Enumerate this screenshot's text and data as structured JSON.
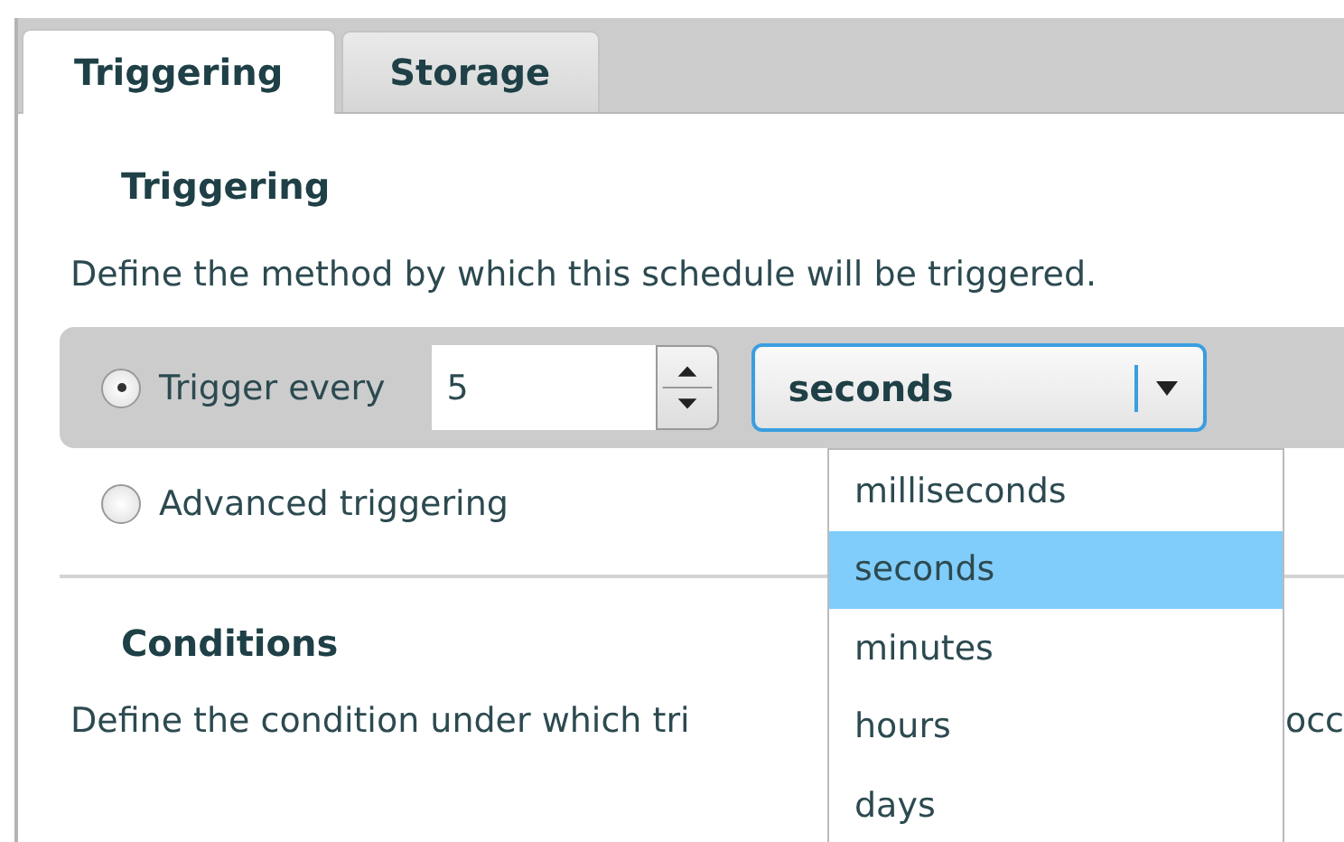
{
  "tabs": [
    {
      "label": "Triggering",
      "selected": true
    },
    {
      "label": "Storage",
      "selected": false
    }
  ],
  "triggering": {
    "heading": "Triggering",
    "description": "Define the method by which this schedule will be triggered.",
    "options": [
      {
        "kind": "interval",
        "label": "Trigger every",
        "selected": true,
        "value": "5",
        "unit": "seconds"
      },
      {
        "kind": "plain",
        "label": "Advanced triggering",
        "selected": false
      }
    ]
  },
  "unit_menu": {
    "items": [
      {
        "label": "milliseconds",
        "selected": false
      },
      {
        "label": "seconds",
        "selected": true
      },
      {
        "label": "minutes",
        "selected": false
      },
      {
        "label": "hours",
        "selected": false
      },
      {
        "label": "days",
        "selected": false
      }
    ]
  },
  "conditions": {
    "heading": "Conditions",
    "description_start": "Define the condition under which tri",
    "description_end": "occ"
  }
}
